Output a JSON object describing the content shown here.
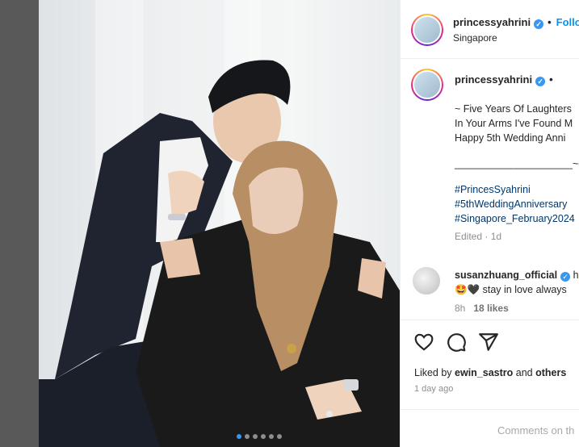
{
  "header": {
    "username": "princessyahrini",
    "follow_label": "Follo",
    "location": "Singapore"
  },
  "caption": {
    "username": "princessyahrini",
    "lines": [
      "~ Five Years Of Laughters",
      "In Your Arms I've Found M",
      "Happy 5th Wedding Anni"
    ],
    "signature": "_____________________~δ",
    "hashtags": [
      "#PrincesSyahrini",
      "#5thWeddingAnniversary",
      "#Singapore_February2024"
    ],
    "edited": "Edited · 1d"
  },
  "comment": {
    "username": "susanzhuang_official",
    "extra": "h",
    "text": "🤩🖤 stay in love always",
    "time": "8h",
    "likes": "18 likes"
  },
  "likes": {
    "prefix": "Liked by ",
    "user": "ewin_sastro",
    "and": " and ",
    "others": "others"
  },
  "post_time": "1 day ago",
  "comment_placeholder": "Comments on th",
  "carousel": {
    "total": 6,
    "active": 0
  },
  "icons": [
    "heart-icon",
    "comment-icon",
    "share-icon",
    "chevron-right-icon",
    "verified-badge-icon"
  ],
  "colors": {
    "verified": "#3897f0",
    "follow": "#0095f6",
    "hashtag": "#00376b"
  }
}
